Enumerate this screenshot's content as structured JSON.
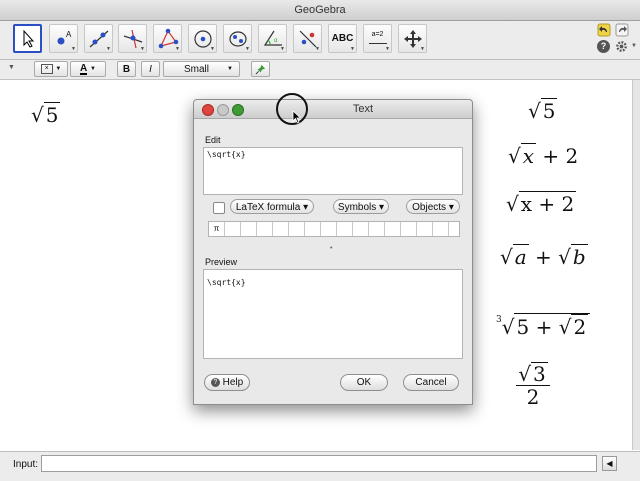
{
  "window": {
    "title": "GeoGebra"
  },
  "toolbar": {
    "tools": [
      {
        "name": "move-tool-icon"
      },
      {
        "name": "point-tool-icon"
      },
      {
        "name": "line-tool-icon"
      },
      {
        "name": "perpendicular-tool-icon"
      },
      {
        "name": "polygon-tool-icon"
      },
      {
        "name": "circle-tool-icon"
      },
      {
        "name": "conic-tool-icon"
      },
      {
        "name": "angle-tool-icon"
      },
      {
        "name": "reflect-tool-icon"
      },
      {
        "name": "text-tool-icon",
        "label": "ABC"
      },
      {
        "name": "slider-tool-icon",
        "label": "a=2"
      },
      {
        "name": "move-view-tool-icon"
      }
    ]
  },
  "stylebar": {
    "bold_label": "B",
    "italic_label": "I",
    "size_value": "Small"
  },
  "graphics": {
    "left_sqrt_radicand": "5",
    "expr1_radicand": "5",
    "expr2_radicand": "x",
    "expr2_rest": " + 2",
    "expr3_radicand": "x + 2",
    "expr4_rad_a": "a",
    "expr4_plus": " + ",
    "expr4_rad_b": "b",
    "expr5_index": "3",
    "expr5_pre": "5 + ",
    "expr5_inner": "2",
    "expr6_num": "3",
    "expr6_den": "2"
  },
  "input_bar": {
    "label": "Input:",
    "value": ""
  },
  "dialog": {
    "title": "Text",
    "edit_label": "Edit",
    "edit_value": "\\sqrt{x}",
    "latex_label": "LaTeX formula",
    "symbols_label": "Symbols",
    "objects_label": "Objects",
    "symbol_first": "π",
    "preview_label": "Preview",
    "preview_value": "\\sqrt{x}",
    "help_label": "Help",
    "ok_label": "OK",
    "cancel_label": "Cancel"
  },
  "colors": {
    "selected_tool_border": "#2a4fc4",
    "close_button": "#e0443e",
    "minimize_button": "#d8a420",
    "zoom_button": "#3f9c35"
  }
}
